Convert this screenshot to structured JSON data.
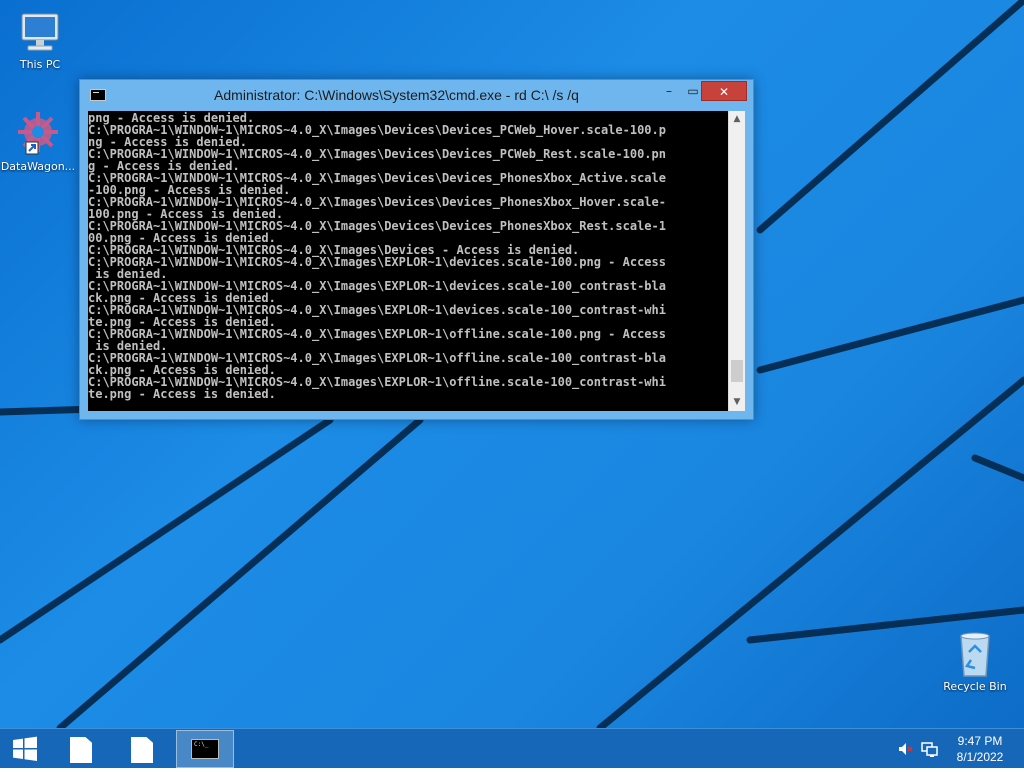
{
  "desktop": {
    "icons": [
      {
        "label": "This PC",
        "icon": "computer-icon"
      },
      {
        "label": "DataWagon...",
        "icon": "gear-shortcut-icon"
      },
      {
        "label": "Recycle Bin",
        "icon": "recycle-bin-icon"
      }
    ]
  },
  "window": {
    "title": "Administrator: C:\\Windows\\System32\\cmd.exe - rd  C:\\ /s /q",
    "minimize": "–",
    "maximize": "▭",
    "close": "✕",
    "console_lines": [
      "png - Access is denied.",
      "C:\\PROGRA~1\\WINDOW~1\\MICROS~4.0_X\\Images\\Devices\\Devices_PCWeb_Hover.scale-100.p",
      "ng - Access is denied.",
      "C:\\PROGRA~1\\WINDOW~1\\MICROS~4.0_X\\Images\\Devices\\Devices_PCWeb_Rest.scale-100.pn",
      "g - Access is denied.",
      "C:\\PROGRA~1\\WINDOW~1\\MICROS~4.0_X\\Images\\Devices\\Devices_PhonesXbox_Active.scale",
      "-100.png - Access is denied.",
      "C:\\PROGRA~1\\WINDOW~1\\MICROS~4.0_X\\Images\\Devices\\Devices_PhonesXbox_Hover.scale-",
      "100.png - Access is denied.",
      "C:\\PROGRA~1\\WINDOW~1\\MICROS~4.0_X\\Images\\Devices\\Devices_PhonesXbox_Rest.scale-1",
      "00.png - Access is denied.",
      "C:\\PROGRA~1\\WINDOW~1\\MICROS~4.0_X\\Images\\Devices - Access is denied.",
      "C:\\PROGRA~1\\WINDOW~1\\MICROS~4.0_X\\Images\\EXPLOR~1\\devices.scale-100.png - Access",
      " is denied.",
      "C:\\PROGRA~1\\WINDOW~1\\MICROS~4.0_X\\Images\\EXPLOR~1\\devices.scale-100_contrast-bla",
      "ck.png - Access is denied.",
      "C:\\PROGRA~1\\WINDOW~1\\MICROS~4.0_X\\Images\\EXPLOR~1\\devices.scale-100_contrast-whi",
      "te.png - Access is denied.",
      "C:\\PROGRA~1\\WINDOW~1\\MICROS~4.0_X\\Images\\EXPLOR~1\\offline.scale-100.png - Access",
      " is denied.",
      "C:\\PROGRA~1\\WINDOW~1\\MICROS~4.0_X\\Images\\EXPLOR~1\\offline.scale-100_contrast-bla",
      "ck.png - Access is denied.",
      "C:\\PROGRA~1\\WINDOW~1\\MICROS~4.0_X\\Images\\EXPLOR~1\\offline.scale-100_contrast-whi",
      "te.png - Access is denied."
    ],
    "scroll_position": 0.95
  },
  "taskbar": {
    "start": "windows-logo-icon",
    "items": [
      {
        "icon": "file-icon"
      },
      {
        "icon": "file-icon"
      },
      {
        "icon": "cmd-icon",
        "active": true,
        "glyph": "C:\\_"
      }
    ],
    "tray": {
      "sound": "speaker-muted-icon",
      "network": "network-icon"
    },
    "time": "9:47 PM",
    "date": "8/1/2022"
  },
  "colors": {
    "desktop_blue": "#1c8ce6",
    "console_bg": "#000000",
    "console_text": "#c0c0c0",
    "close_red": "#c7423a",
    "taskbar": "#1767b8"
  }
}
